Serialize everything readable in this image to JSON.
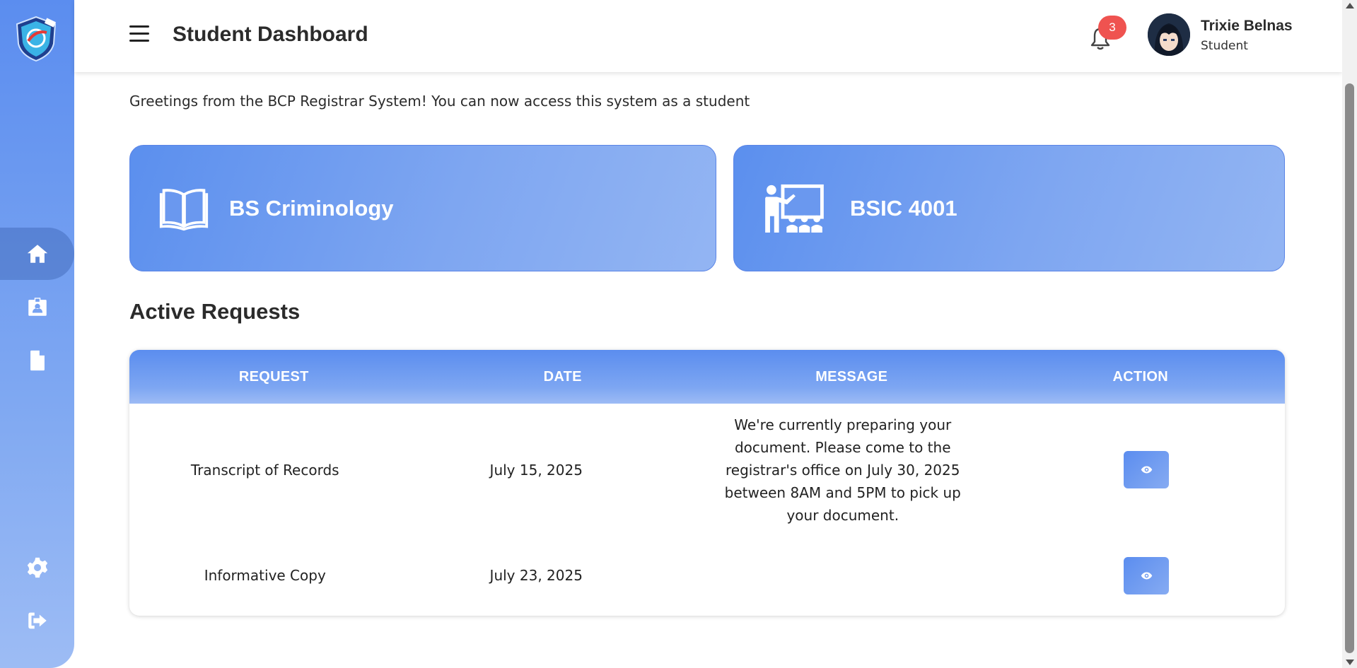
{
  "header": {
    "title": "Student Dashboard",
    "notification_count": "3",
    "user_name": "Trixie Belnas",
    "user_role": "Student"
  },
  "sidebar": {
    "items": [
      {
        "name": "home",
        "icon": "home-icon",
        "active": true
      },
      {
        "name": "profile",
        "icon": "id-badge-icon",
        "active": false
      },
      {
        "name": "documents",
        "icon": "file-icon",
        "active": false
      },
      {
        "name": "settings",
        "icon": "gear-icon",
        "active": false
      },
      {
        "name": "logout",
        "icon": "logout-icon",
        "active": false
      }
    ]
  },
  "welcome": {
    "greeting": "Greetings from the BCP Registrar System! You can now access this system as a student"
  },
  "cards": [
    {
      "label": "BS Criminology",
      "icon": "open-book-icon"
    },
    {
      "label": "BSIC 4001",
      "icon": "teacher-class-icon"
    }
  ],
  "requests": {
    "title": "Active Requests",
    "columns": [
      "REQUEST",
      "DATE",
      "MESSAGE",
      "ACTION"
    ],
    "rows": [
      {
        "request": "Transcript of Records",
        "date": "July 15, 2025",
        "message": "We're currently preparing your document. Please come to the registrar's office on July 30, 2025 between 8AM and 5PM to pick up your document."
      },
      {
        "request": "Informative Copy",
        "date": "July 23, 2025",
        "message": ""
      }
    ]
  },
  "colors": {
    "accent": "#5b8def",
    "badge": "#ef5350"
  }
}
